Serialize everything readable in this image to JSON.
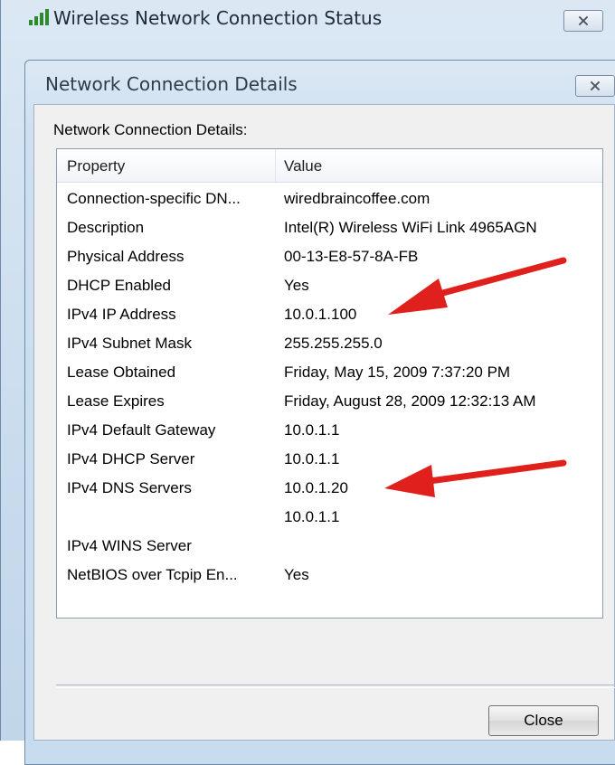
{
  "outer_window": {
    "title": "Wireless Network Connection Status",
    "title_icon": "signal-bars-icon",
    "close_icon": "close-icon"
  },
  "dialog": {
    "title": "Network Connection Details",
    "close_icon": "close-icon",
    "section_label": "Network Connection Details:",
    "columns": [
      "Property",
      "Value"
    ],
    "rows": [
      {
        "property": "Connection-specific DN...",
        "value": "wiredbraincoffee.com"
      },
      {
        "property": "Description",
        "value": "Intel(R) Wireless WiFi Link 4965AGN"
      },
      {
        "property": "Physical Address",
        "value": "00-13-E8-57-8A-FB"
      },
      {
        "property": "DHCP Enabled",
        "value": "Yes"
      },
      {
        "property": "IPv4 IP Address",
        "value": "10.0.1.100"
      },
      {
        "property": "IPv4 Subnet Mask",
        "value": "255.255.255.0"
      },
      {
        "property": "Lease Obtained",
        "value": "Friday, May 15, 2009 7:37:20 PM"
      },
      {
        "property": "Lease Expires",
        "value": "Friday, August 28, 2009 12:32:13 AM"
      },
      {
        "property": "IPv4 Default Gateway",
        "value": "10.0.1.1"
      },
      {
        "property": "IPv4 DHCP Server",
        "value": "10.0.1.1"
      },
      {
        "property": "IPv4 DNS Servers",
        "value": "10.0.1.20"
      },
      {
        "property": "",
        "value": "10.0.1.1"
      },
      {
        "property": "IPv4 WINS Server",
        "value": ""
      },
      {
        "property": "NetBIOS over Tcpip En...",
        "value": "Yes"
      }
    ],
    "close_button": "Close"
  },
  "annotations": {
    "arrow_color": "#e0201c",
    "arrows": [
      "red-arrow-icon",
      "red-arrow-icon"
    ]
  }
}
